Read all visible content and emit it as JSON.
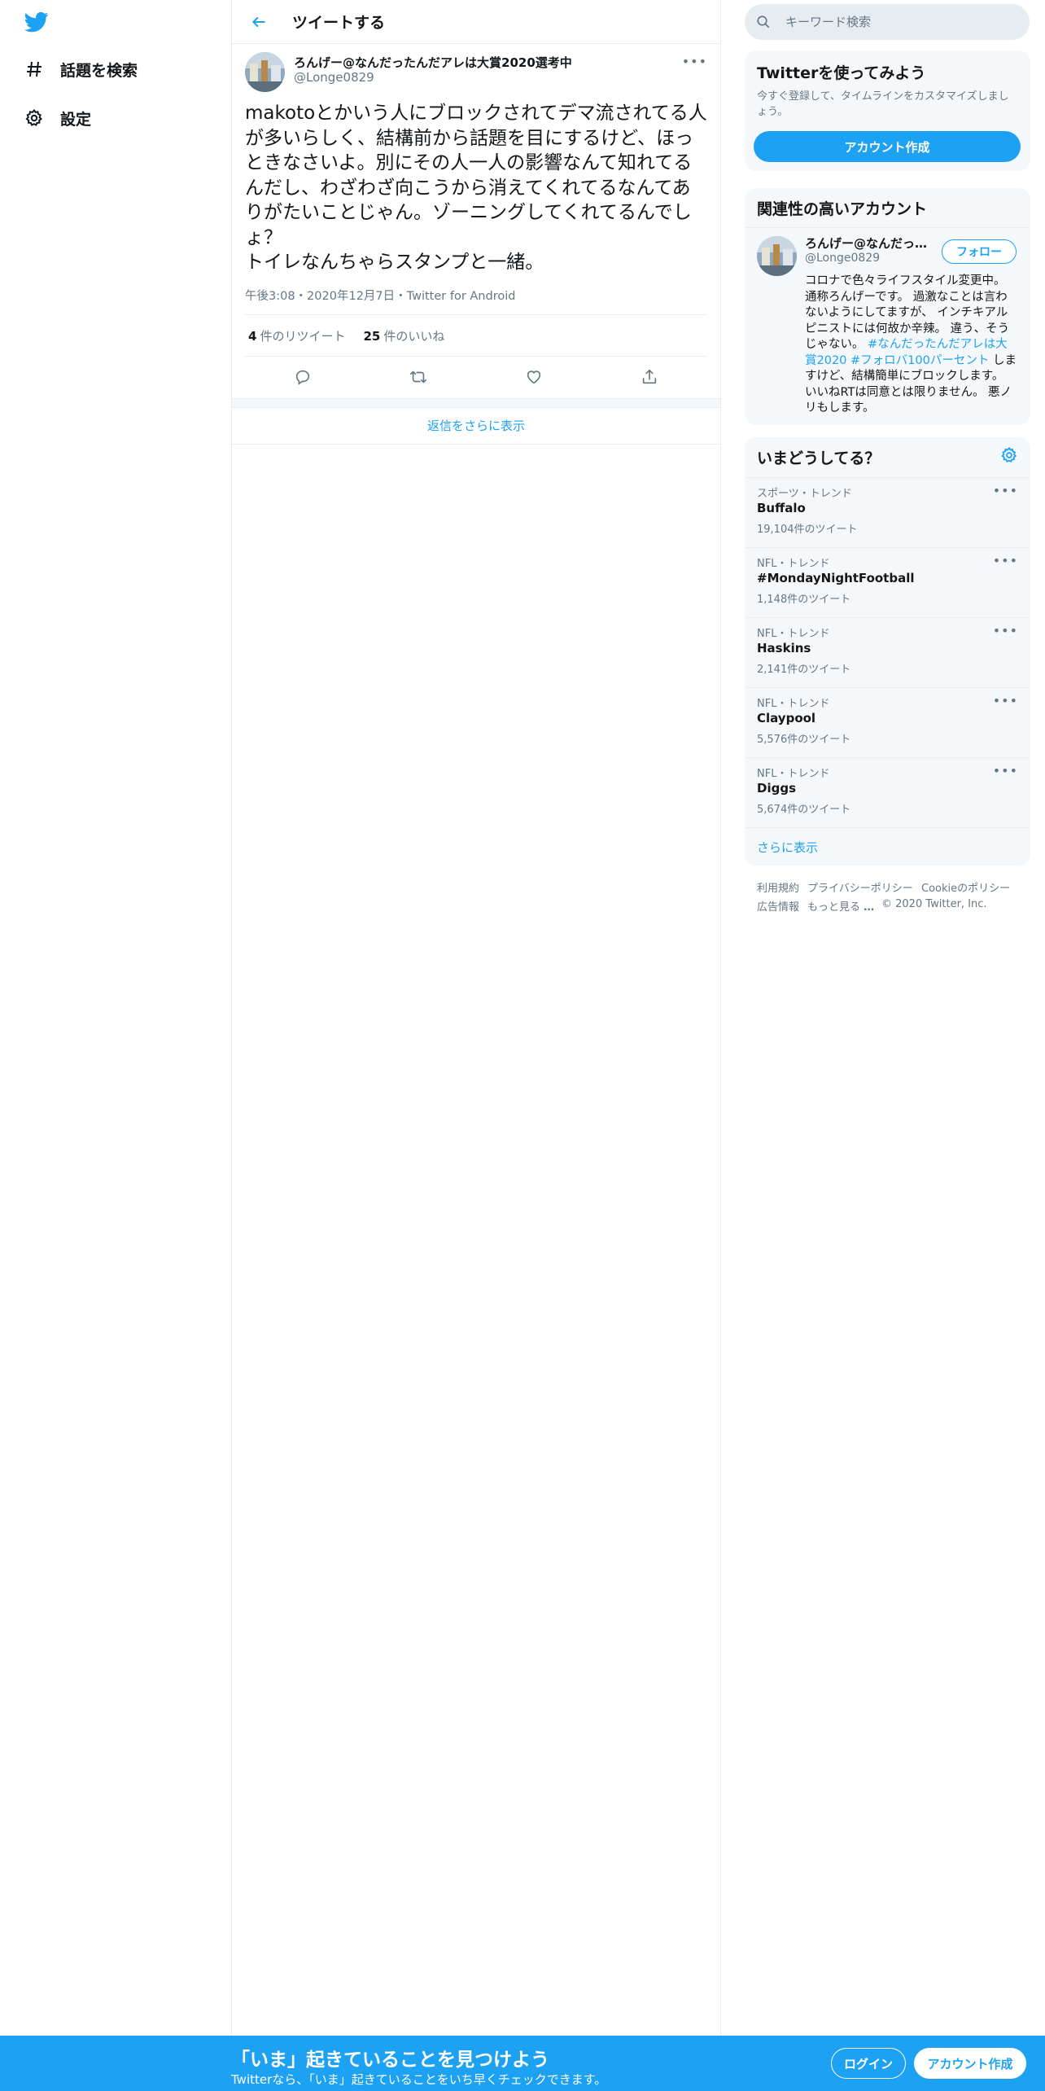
{
  "nav": {
    "items": [
      {
        "label": "話題を検索",
        "icon": "hashtag-icon"
      },
      {
        "label": "設定",
        "icon": "gear-icon"
      }
    ]
  },
  "header": {
    "title": "ツイートする"
  },
  "tweet": {
    "author_name": "ろんげー@なんだったんだアレは大賞2020選考中",
    "handle": "@Longe0829",
    "text": "makotoとかいう人にブロックされてデマ流されてる人が多いらしく、結構前から話題を目にするけど、ほっときなさいよ。別にその人一人の影響なんて知れてるんだし、わざわざ向こうから消えてくれてるなんてありがたいことじゃん。ゾーニングしてくれてるんでしょ？\nトイレなんちゃらスタンプと一緒。",
    "meta": "午後3:08・2020年12月7日・Twitter for Android",
    "retweets": "4",
    "retweets_label": "件のリツイート",
    "likes": "25",
    "likes_label": "件のいいね",
    "show_more_replies": "返信をさらに表示"
  },
  "search": {
    "placeholder": "キーワード検索"
  },
  "signup_card": {
    "title": "Twitterを使ってみよう",
    "subtitle": "今すぐ登録して、タイムラインをカスタマイズしましょう。",
    "button": "アカウント作成"
  },
  "related": {
    "title": "関連性の高いアカウント",
    "name": "ろんげー@なんだっ…",
    "handle": "@Longe0829",
    "follow": "フォロー",
    "bio_1": "コロナで色々ライフスタイル変更中。通称ろんげーです。 過激なことは言わないようにしてますが、 インチキアルピニストには何故か辛辣。 違う、そうじゃない。 ",
    "bio_tag_1": "#なんだったんだアレは大賞2020",
    "bio_tag_2": "#フォロバ100パーセント",
    "bio_2": " しますけど、結構簡単にブロックします。 いいねRTは同意とは限りません。 悪ノリもします。"
  },
  "trends": {
    "title": "いまどうしてる？",
    "items": [
      {
        "category": "スポーツ・トレンド",
        "name": "Buffalo",
        "count": "19,104件のツイート"
      },
      {
        "category": "NFL・トレンド",
        "name": "#MondayNightFootball",
        "count": "1,148件のツイート"
      },
      {
        "category": "NFL・トレンド",
        "name": "Haskins",
        "count": "2,141件のツイート"
      },
      {
        "category": "NFL・トレンド",
        "name": "Claypool",
        "count": "5,576件のツイート"
      },
      {
        "category": "NFL・トレンド",
        "name": "Diggs",
        "count": "5,674件のツイート"
      }
    ],
    "show_more": "さらに表示"
  },
  "footer": {
    "terms": "利用規約",
    "privacy": "プライバシーポリシー",
    "cookie": "Cookieのポリシー",
    "ads": "広告情報",
    "more": "もっと見る",
    "copyright": "© 2020 Twitter, Inc."
  },
  "bottom_bar": {
    "title": "「いま」起きていることを見つけよう",
    "subtitle": "Twitterなら、「いま」起きていることをいち早くチェックできます。",
    "login": "ログイン",
    "signup": "アカウント作成"
  },
  "colors": {
    "accent": "#1da1f2",
    "text": "#14171a",
    "muted": "#657786",
    "border": "#e6ecf0",
    "panel": "#f5f8fa"
  }
}
